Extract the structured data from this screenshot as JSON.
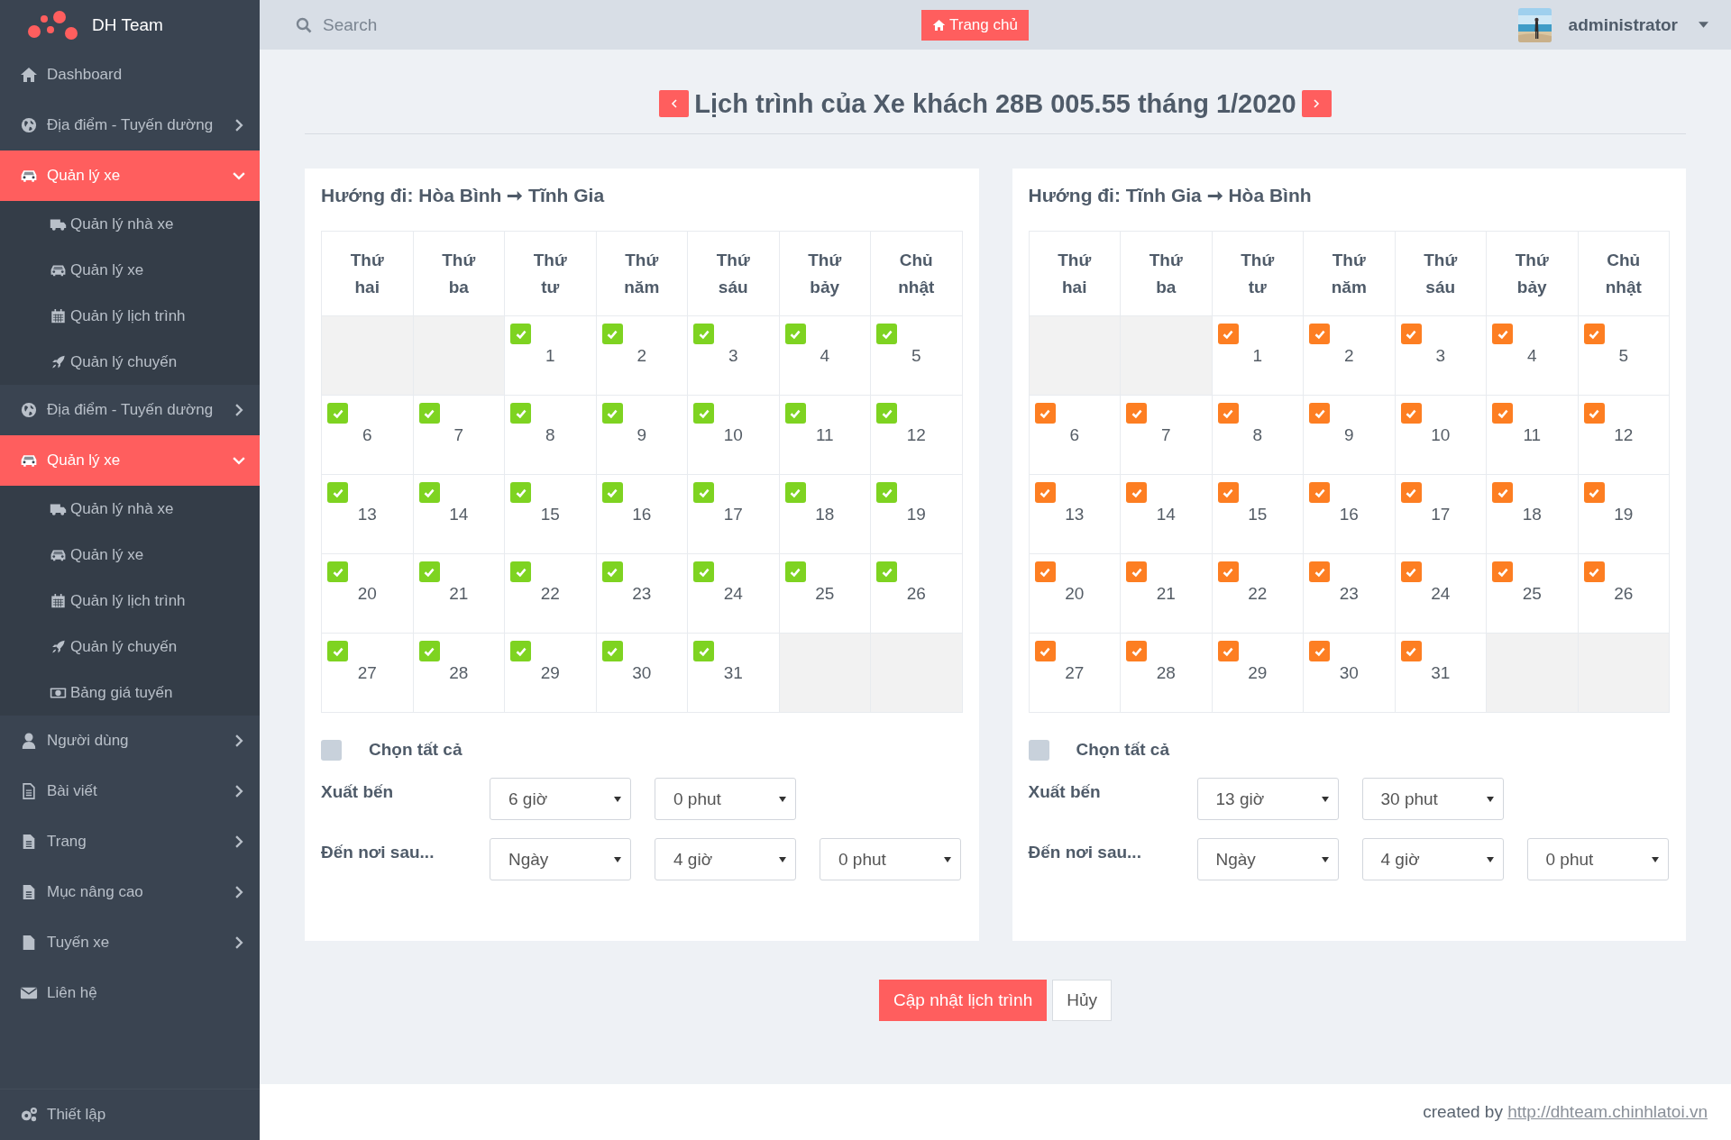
{
  "brand": "DH Team",
  "sidebar": {
    "items": [
      {
        "label": "Dashboard",
        "selected": false
      },
      {
        "label": "Địa điểm - Tuyến dường",
        "selected": false,
        "expanded": false
      },
      {
        "label": "Quản lý xe",
        "selected": true,
        "expanded": true,
        "children": [
          {
            "label": "Quản lý nhà xe"
          },
          {
            "label": "Quản lý xe"
          },
          {
            "label": "Quản lý lịch trình"
          },
          {
            "label": "Quản lý chuyến"
          }
        ]
      },
      {
        "label": "Địa điểm - Tuyến dường",
        "selected": false,
        "expanded": false
      },
      {
        "label": "Quản lý xe",
        "selected": true,
        "expanded": true,
        "children": [
          {
            "label": "Quản lý nhà xe"
          },
          {
            "label": "Quản lý xe"
          },
          {
            "label": "Quản lý lịch trình"
          },
          {
            "label": "Quản lý chuyến"
          },
          {
            "label": "Bảng giá tuyến"
          }
        ]
      },
      {
        "label": "Người dùng",
        "selected": false,
        "expanded": false
      },
      {
        "label": "Bài viết",
        "selected": false,
        "expanded": false
      },
      {
        "label": "Trang",
        "selected": false,
        "expanded": false
      },
      {
        "label": "Mục nâng cao",
        "selected": false,
        "expanded": false
      },
      {
        "label": "Tuyến xe",
        "selected": false,
        "expanded": false
      },
      {
        "label": "Liên hệ",
        "selected": false
      }
    ],
    "footer": {
      "label": "Thiết lập"
    }
  },
  "topbar": {
    "search": {
      "placeholder": "Search"
    },
    "home_button": "Trang chủ",
    "user": "administrator"
  },
  "title": "Lịch trình của Xe khách 28B 005.55 tháng 1/2020",
  "directions": [
    {
      "heading": "Hướng đi: Hòa Bình ➞ Tĩnh Gia",
      "color": "#7ed321",
      "weekdays": [
        "Thứ hai",
        "Thứ ba",
        "Thứ tư",
        "Thứ năm",
        "Thứ sáu",
        "Thứ bảy",
        "Chủ nhật"
      ],
      "weeks": [
        [
          {
            "kind": "empty"
          },
          {
            "kind": "empty"
          },
          {
            "kind": "day",
            "day": "1",
            "checked": true
          },
          {
            "kind": "day",
            "day": "2",
            "checked": true
          },
          {
            "kind": "day",
            "day": "3",
            "checked": true
          },
          {
            "kind": "day",
            "day": "4",
            "checked": true
          },
          {
            "kind": "day",
            "day": "5",
            "checked": true
          }
        ],
        [
          {
            "kind": "day",
            "day": "6",
            "checked": true
          },
          {
            "kind": "day",
            "day": "7",
            "checked": true
          },
          {
            "kind": "day",
            "day": "8",
            "checked": true
          },
          {
            "kind": "day",
            "day": "9",
            "checked": true
          },
          {
            "kind": "day",
            "day": "10",
            "checked": true
          },
          {
            "kind": "day",
            "day": "11",
            "checked": true
          },
          {
            "kind": "day",
            "day": "12",
            "checked": true
          }
        ],
        [
          {
            "kind": "day",
            "day": "13",
            "checked": true
          },
          {
            "kind": "day",
            "day": "14",
            "checked": true
          },
          {
            "kind": "day",
            "day": "15",
            "checked": true
          },
          {
            "kind": "day",
            "day": "16",
            "checked": true
          },
          {
            "kind": "day",
            "day": "17",
            "checked": true
          },
          {
            "kind": "day",
            "day": "18",
            "checked": true
          },
          {
            "kind": "day",
            "day": "19",
            "checked": true
          }
        ],
        [
          {
            "kind": "day",
            "day": "20",
            "checked": true
          },
          {
            "kind": "day",
            "day": "21",
            "checked": true
          },
          {
            "kind": "day",
            "day": "22",
            "checked": true
          },
          {
            "kind": "day",
            "day": "23",
            "checked": true
          },
          {
            "kind": "day",
            "day": "24",
            "checked": true
          },
          {
            "kind": "day",
            "day": "25",
            "checked": true
          },
          {
            "kind": "day",
            "day": "26",
            "checked": true
          }
        ],
        [
          {
            "kind": "day",
            "day": "27",
            "checked": true
          },
          {
            "kind": "day",
            "day": "28",
            "checked": true
          },
          {
            "kind": "day",
            "day": "29",
            "checked": true
          },
          {
            "kind": "day",
            "day": "30",
            "checked": true
          },
          {
            "kind": "day",
            "day": "31",
            "checked": true
          },
          {
            "kind": "empty"
          },
          {
            "kind": "empty"
          }
        ]
      ],
      "select_all": {
        "label": "Chọn tất cả",
        "checked": false
      },
      "departure": {
        "label": "Xuất bến",
        "values": [
          "6 giờ",
          "0 phut"
        ]
      },
      "arrival": {
        "label": "Đến nơi sau...",
        "values": [
          "Ngày",
          "4 giờ",
          "0 phut"
        ]
      }
    },
    {
      "heading": "Hướng đi: Tĩnh Gia ➞ Hòa Bình",
      "color": "#fd7e22",
      "weekdays": [
        "Thứ hai",
        "Thứ ba",
        "Thứ tư",
        "Thứ năm",
        "Thứ sáu",
        "Thứ bảy",
        "Chủ nhật"
      ],
      "weeks": [
        [
          {
            "kind": "empty"
          },
          {
            "kind": "empty"
          },
          {
            "kind": "day",
            "day": "1",
            "checked": true
          },
          {
            "kind": "day",
            "day": "2",
            "checked": true
          },
          {
            "kind": "day",
            "day": "3",
            "checked": true
          },
          {
            "kind": "day",
            "day": "4",
            "checked": true
          },
          {
            "kind": "day",
            "day": "5",
            "checked": true
          }
        ],
        [
          {
            "kind": "day",
            "day": "6",
            "checked": true
          },
          {
            "kind": "day",
            "day": "7",
            "checked": true
          },
          {
            "kind": "day",
            "day": "8",
            "checked": true
          },
          {
            "kind": "day",
            "day": "9",
            "checked": true
          },
          {
            "kind": "day",
            "day": "10",
            "checked": true
          },
          {
            "kind": "day",
            "day": "11",
            "checked": true
          },
          {
            "kind": "day",
            "day": "12",
            "checked": true
          }
        ],
        [
          {
            "kind": "day",
            "day": "13",
            "checked": true
          },
          {
            "kind": "day",
            "day": "14",
            "checked": true
          },
          {
            "kind": "day",
            "day": "15",
            "checked": true
          },
          {
            "kind": "day",
            "day": "16",
            "checked": true
          },
          {
            "kind": "day",
            "day": "17",
            "checked": true
          },
          {
            "kind": "day",
            "day": "18",
            "checked": true
          },
          {
            "kind": "day",
            "day": "19",
            "checked": true
          }
        ],
        [
          {
            "kind": "day",
            "day": "20",
            "checked": true
          },
          {
            "kind": "day",
            "day": "21",
            "checked": true
          },
          {
            "kind": "day",
            "day": "22",
            "checked": true
          },
          {
            "kind": "day",
            "day": "23",
            "checked": true
          },
          {
            "kind": "day",
            "day": "24",
            "checked": true
          },
          {
            "kind": "day",
            "day": "25",
            "checked": true
          },
          {
            "kind": "day",
            "day": "26",
            "checked": true
          }
        ],
        [
          {
            "kind": "day",
            "day": "27",
            "checked": true
          },
          {
            "kind": "day",
            "day": "28",
            "checked": true
          },
          {
            "kind": "day",
            "day": "29",
            "checked": true
          },
          {
            "kind": "day",
            "day": "30",
            "checked": true
          },
          {
            "kind": "day",
            "day": "31",
            "checked": true
          },
          {
            "kind": "empty"
          },
          {
            "kind": "empty"
          }
        ]
      ],
      "select_all": {
        "label": "Chọn tất cả",
        "checked": false
      },
      "departure": {
        "label": "Xuất bến",
        "values": [
          "13 giờ",
          "30 phut"
        ]
      },
      "arrival": {
        "label": "Đến nơi sau...",
        "values": [
          "Ngày",
          "4 giờ",
          "0 phut"
        ]
      }
    }
  ],
  "actions": {
    "save": "Cập nhật lịch trình",
    "cancel": "Hủy"
  },
  "footer": {
    "prefix": "created by ",
    "link": "http://dhteam.chinhlatoi.vn"
  }
}
